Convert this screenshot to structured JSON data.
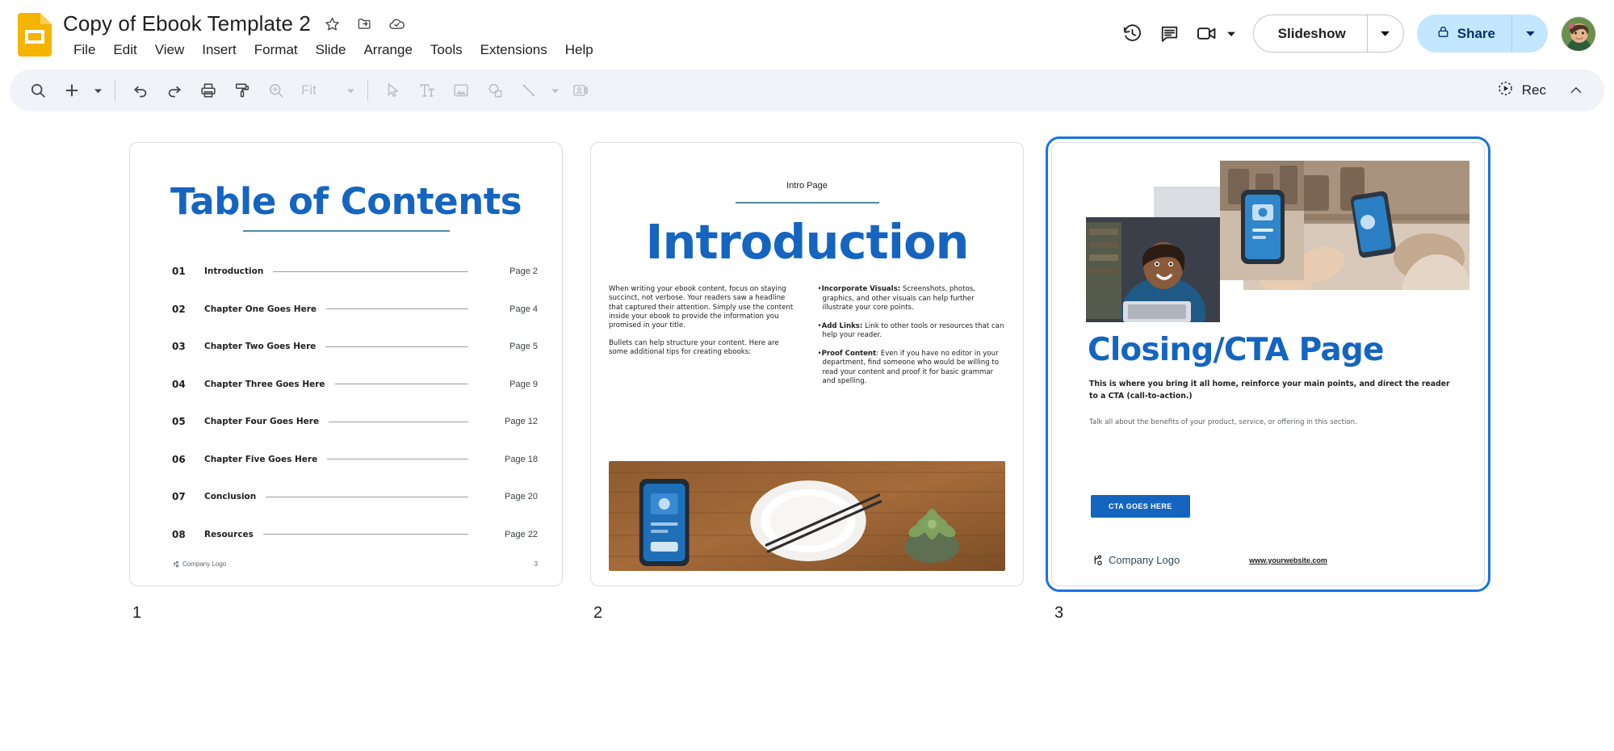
{
  "app": {
    "name": "Google Slides",
    "icon": "slides-app-icon"
  },
  "header": {
    "doc_title": "Copy of Ebook Template 2",
    "title_icons": [
      {
        "name": "star-icon",
        "label": "Star"
      },
      {
        "name": "move-to-folder-icon",
        "label": "Move"
      },
      {
        "name": "cloud-saved-icon",
        "label": "Saved to Drive"
      }
    ],
    "menus": [
      "File",
      "Edit",
      "View",
      "Insert",
      "Format",
      "Slide",
      "Arrange",
      "Tools",
      "Extensions",
      "Help"
    ],
    "right_icons": [
      {
        "name": "version-history-icon",
        "label": "Last edit"
      },
      {
        "name": "comment-icon",
        "label": "Open comment history"
      },
      {
        "name": "meet-icon",
        "label": "Join call"
      }
    ],
    "slideshow": {
      "label": "Slideshow",
      "caret": "▾"
    },
    "share": {
      "label": "Share",
      "lock_icon": "lock-icon",
      "caret": "▾"
    },
    "avatar": {
      "name": "user-avatar",
      "alt": "Account"
    }
  },
  "toolbar": {
    "items": [
      {
        "name": "search-icon",
        "label": "Search the menus",
        "dim": false
      },
      {
        "name": "add-slide-icon",
        "label": "New slide",
        "dim": false
      },
      {
        "name": "add-slide-caret",
        "label": "New slide options",
        "dim": false
      },
      {
        "name": "undo-icon",
        "label": "Undo",
        "dim": false
      },
      {
        "name": "redo-icon",
        "label": "Redo",
        "dim": false
      },
      {
        "name": "print-icon",
        "label": "Print",
        "dim": false
      },
      {
        "name": "paint-format-icon",
        "label": "Paint format",
        "dim": false
      },
      {
        "name": "zoom-icon",
        "label": "Zoom",
        "dim": true
      },
      {
        "name": "select-icon",
        "label": "Select",
        "dim": false
      },
      {
        "name": "text-box-icon",
        "label": "Text box",
        "dim": false
      },
      {
        "name": "insert-image-icon",
        "label": "Insert image",
        "dim": false
      },
      {
        "name": "shape-icon",
        "label": "Shape",
        "dim": false
      },
      {
        "name": "line-icon",
        "label": "Line",
        "dim": false
      },
      {
        "name": "line-caret",
        "label": "Line options",
        "dim": false
      },
      {
        "name": "insert-video-icon",
        "label": "Insert video",
        "dim": false
      }
    ],
    "zoom_value": "Fit",
    "zoom_caret": "▾",
    "rec_label": "Rec",
    "collapse_caret": "⌃"
  },
  "slides": [
    {
      "number": "1",
      "type": "table-of-contents",
      "selected": false,
      "title": "Table of Contents",
      "entries": [
        {
          "num": "01",
          "label": "Introduction",
          "page": "Page 2"
        },
        {
          "num": "02",
          "label": "Chapter One Goes Here",
          "page": "Page 4"
        },
        {
          "num": "03",
          "label": "Chapter Two Goes Here",
          "page": "Page 5"
        },
        {
          "num": "04",
          "label": "Chapter Three Goes Here",
          "page": "Page 9"
        },
        {
          "num": "05",
          "label": "Chapter Four Goes Here",
          "page": "Page 12"
        },
        {
          "num": "06",
          "label": "Chapter Five Goes Here",
          "page": "Page 18"
        },
        {
          "num": "07",
          "label": "Conclusion",
          "page": "Page 20"
        },
        {
          "num": "08",
          "label": "Resources",
          "page": "Page 22"
        }
      ],
      "footer_logo": "Company Logo",
      "footer_page": "3"
    },
    {
      "number": "2",
      "type": "introduction",
      "selected": false,
      "eyebrow": "Intro Page",
      "title": "Introduction",
      "left_paragraphs": [
        "When writing your ebook content, focus on staying succinct, not verbose. Your readers saw a headline that captured their attention. Simply use the content inside your ebook to provide the information you promised in your title.",
        "Bullets can help structure your content. Here are some additional tips for creating ebooks:"
      ],
      "bullets": [
        {
          "lead": "Incorporate Visuals:",
          "text": " Screenshots, photos, graphics, and other visuals can help further illustrate your core points."
        },
        {
          "lead": "Add Links:",
          "text": " Link to other tools or resources that can help your reader."
        },
        {
          "lead": "Proof Content",
          "text": ": Even if you have no editor in your department, find someone who would be willing to read your content and proof it for basic grammar and spelling."
        }
      ],
      "photo_alt": "Smartphone, bowl with chopsticks and a succulent on a wooden table"
    },
    {
      "number": "3",
      "type": "closing-cta",
      "selected": true,
      "title": "Closing/CTA Page",
      "lead": "This is where you bring it all home, reinforce your main points, and direct the reader to a CTA (call-to-action.)",
      "body": "Talk all about the benefits of your product, service, or offering in this section.",
      "cta_label": "CTA GOES HERE",
      "footer_logo": "Company Logo",
      "footer_url": "www.yourwebsite.com",
      "images": [
        {
          "name": "photo-cafe-payment",
          "alt": "Hands using a phone for contactless payment at a cafe counter"
        },
        {
          "name": "photo-woman-laptop",
          "alt": "Smiling woman working on a laptop"
        },
        {
          "name": "photo-phone-device",
          "alt": "Close-up of a smartphone screen"
        },
        {
          "name": "photo-gray-block",
          "alt": "Gray placeholder block"
        }
      ]
    }
  ],
  "colors": {
    "brand_blue": "#1565c0",
    "accent_teal": "#4f8ba0",
    "share_bg": "#c2e7ff",
    "share_fg": "#062e6f",
    "toolbar_bg": "#f0f4f9",
    "selection_blue": "#1a73e8"
  }
}
